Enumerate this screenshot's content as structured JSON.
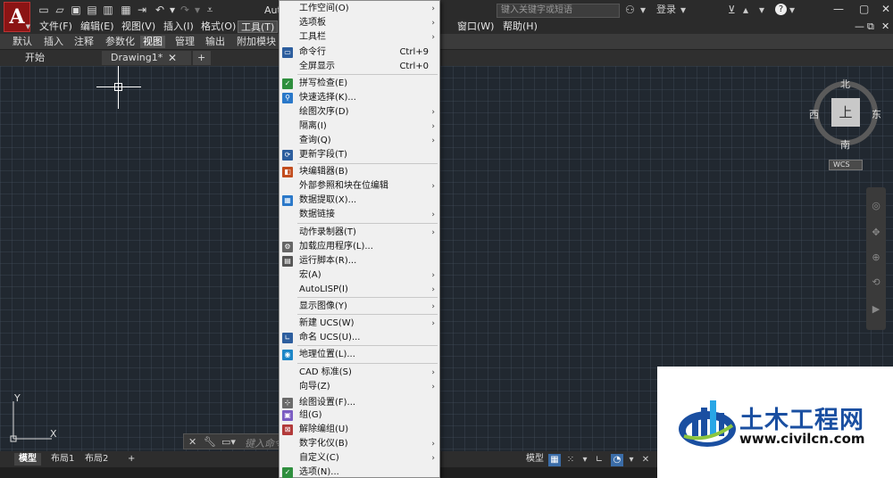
{
  "app": {
    "title": "Aut",
    "logo_letter": "A"
  },
  "search": {
    "placeholder": "键入关键字或短语"
  },
  "account": {
    "login": "登录"
  },
  "menubar": {
    "items": [
      "文件(F)",
      "编辑(E)",
      "视图(V)",
      "插入(I)",
      "格式(O)",
      "工具(T)"
    ],
    "right_items": [
      "窗口(W)",
      "帮助(H)"
    ]
  },
  "ribbon": {
    "tabs": [
      "默认",
      "插入",
      "注释",
      "参数化",
      "视图",
      "管理",
      "输出",
      "附加模块"
    ],
    "active": "视图"
  },
  "doc_tabs": {
    "items": [
      "开始",
      "Drawing1*"
    ],
    "add": "+",
    "close": "✕"
  },
  "viewcube": {
    "north": "北",
    "south": "南",
    "east": "东",
    "west": "西",
    "face": "上",
    "wcs": "WCS"
  },
  "ucs": {
    "y": "Y",
    "x": "X"
  },
  "commandline": {
    "placeholder": "键入命令"
  },
  "status": {
    "layout_tabs": [
      "模型",
      "布局1",
      "布局2"
    ],
    "add": "+",
    "model_label": "模型"
  },
  "tools_menu": {
    "items": [
      {
        "label": "工作空间(O)",
        "arrow": true
      },
      {
        "label": "选项板",
        "arrow": true
      },
      {
        "label": "工具栏",
        "arrow": true
      },
      {
        "label": "命令行",
        "shortcut": "Ctrl+9",
        "icon": "command-line-icon"
      },
      {
        "label": "全屏显示",
        "shortcut": "Ctrl+0"
      },
      {
        "label": "拼写检查(E)",
        "icon": "spell-check-icon"
      },
      {
        "label": "快速选择(K)...",
        "icon": "quick-select-icon"
      },
      {
        "label": "绘图次序(D)",
        "arrow": true
      },
      {
        "label": "隔离(I)",
        "arrow": true
      },
      {
        "label": "查询(Q)",
        "arrow": true
      },
      {
        "label": "更新字段(T)",
        "icon": "update-field-icon"
      },
      {
        "label": "块编辑器(B)",
        "icon": "block-editor-icon"
      },
      {
        "label": "外部参照和块在位编辑",
        "arrow": true
      },
      {
        "label": "数据提取(X)...",
        "icon": "data-extraction-icon"
      },
      {
        "label": "数据链接",
        "arrow": true
      },
      {
        "label": "动作录制器(T)",
        "arrow": true
      },
      {
        "label": "加载应用程序(L)...",
        "icon": "load-app-icon"
      },
      {
        "label": "运行脚本(R)...",
        "icon": "run-script-icon"
      },
      {
        "label": "宏(A)",
        "arrow": true
      },
      {
        "label": "AutoLISP(I)",
        "arrow": true
      },
      {
        "label": "显示图像(Y)",
        "arrow": true
      },
      {
        "label": "新建 UCS(W)",
        "arrow": true
      },
      {
        "label": "命名 UCS(U)...",
        "icon": "named-ucs-icon"
      },
      {
        "label": "地理位置(L)...",
        "icon": "geo-location-icon"
      },
      {
        "label": "CAD 标准(S)",
        "arrow": true
      },
      {
        "label": "向导(Z)",
        "arrow": true
      },
      {
        "label": "绘图设置(F)...",
        "icon": "drafting-settings-icon"
      },
      {
        "label": "组(G)",
        "icon": "group-icon"
      },
      {
        "label": "解除编组(U)",
        "icon": "ungroup-icon"
      },
      {
        "label": "数字化仪(B)",
        "arrow": true
      },
      {
        "label": "自定义(C)",
        "arrow": true
      },
      {
        "label": "选项(N)...",
        "icon": "options-icon"
      }
    ]
  },
  "watermark": {
    "name": "土木工程网",
    "url": "www.civilcn.com"
  }
}
